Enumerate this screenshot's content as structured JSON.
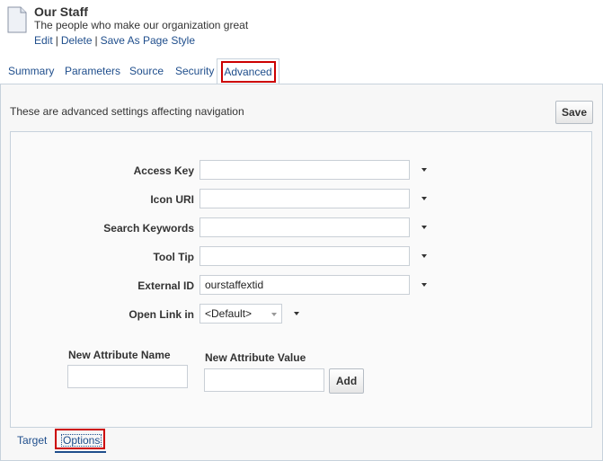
{
  "header": {
    "title": "Our Staff",
    "subtitle": "The people who make our organization great",
    "actions": {
      "edit": "Edit",
      "delete": "Delete",
      "save_as_style": "Save As Page Style",
      "separator": "|"
    }
  },
  "tabs": [
    {
      "label": "Summary"
    },
    {
      "label": "Parameters"
    },
    {
      "label": "Source"
    },
    {
      "label": "Security"
    },
    {
      "label": "Advanced",
      "active": true
    }
  ],
  "panel": {
    "description": "These are advanced settings affecting navigation",
    "save_label": "Save"
  },
  "form": {
    "access_key": {
      "label": "Access Key",
      "value": ""
    },
    "icon_uri": {
      "label": "Icon URI",
      "value": ""
    },
    "search_keywords": {
      "label": "Search Keywords",
      "value": ""
    },
    "tool_tip": {
      "label": "Tool Tip",
      "value": ""
    },
    "external_id": {
      "label": "External ID",
      "value": "ourstaffextid"
    },
    "open_link_in": {
      "label": "Open Link in",
      "value": "<Default>"
    }
  },
  "attributes": {
    "name_label": "New Attribute Name",
    "value_label": "New Attribute Value",
    "add_label": "Add"
  },
  "bottom_tabs": [
    {
      "label": "Target"
    },
    {
      "label": "Options",
      "active": true
    }
  ],
  "colors": {
    "link": "#1f4e8c",
    "highlight": "#cc0000",
    "border": "#c7d2dc"
  }
}
